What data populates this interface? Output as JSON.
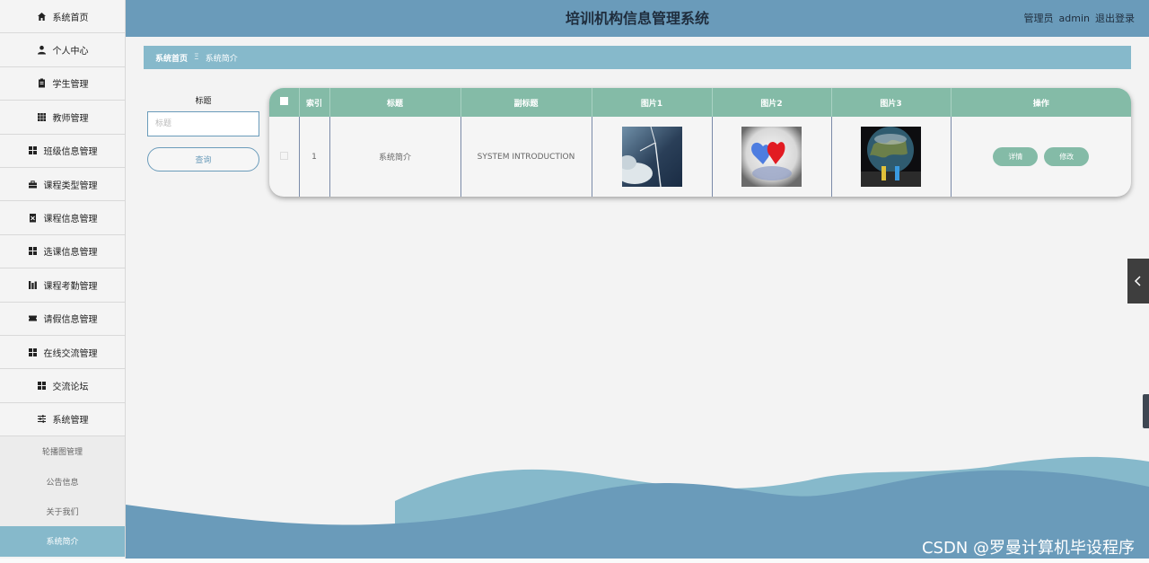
{
  "app": {
    "title": "培训机构信息管理系统"
  },
  "header": {
    "user_role": "管理员",
    "user_name": "admin",
    "logout": "退出登录"
  },
  "sidebar": {
    "items": [
      {
        "label": "系统首页",
        "icon": "home-icon"
      },
      {
        "label": "个人中心",
        "icon": "user-icon"
      },
      {
        "label": "学生管理",
        "icon": "clipboard-icon"
      },
      {
        "label": "教师管理",
        "icon": "grid-icon"
      },
      {
        "label": "班级信息管理",
        "icon": "apps-icon"
      },
      {
        "label": "课程类型管理",
        "icon": "briefcase-icon"
      },
      {
        "label": "课程信息管理",
        "icon": "document-icon"
      },
      {
        "label": "选课信息管理",
        "icon": "apps-icon"
      },
      {
        "label": "课程考勤管理",
        "icon": "chart-icon"
      },
      {
        "label": "请假信息管理",
        "icon": "ticket-icon"
      },
      {
        "label": "在线交流管理",
        "icon": "apps-icon"
      },
      {
        "label": "交流论坛",
        "icon": "apps-icon"
      },
      {
        "label": "系统管理",
        "icon": "sliders-icon"
      }
    ],
    "sub_items": [
      {
        "label": "轮播图管理"
      },
      {
        "label": "公告信息"
      },
      {
        "label": "关于我们"
      },
      {
        "label": "系统简介"
      }
    ]
  },
  "breadcrumb": {
    "home": "系统首页",
    "separator": "Ξ",
    "current": "系统简介"
  },
  "search": {
    "label": "标题",
    "placeholder": "标题",
    "value": "",
    "button": "查询"
  },
  "table": {
    "headers": [
      "",
      "索引",
      "标题",
      "副标题",
      "图片1",
      "图片2",
      "图片3",
      "操作"
    ],
    "rows": [
      {
        "index": "1",
        "title": "系统简介",
        "subtitle": "SYSTEM INTRODUCTION"
      }
    ],
    "actions": {
      "detail": "详情",
      "edit": "修改"
    }
  },
  "watermark": "CSDN @罗曼计算机毕设程序",
  "colors": {
    "header": "#6a9bba",
    "breadcrumb": "#86b9cb",
    "table_head": "#84bba7",
    "wave_light": "#86b9cb",
    "wave_dark": "#6a9bba"
  }
}
